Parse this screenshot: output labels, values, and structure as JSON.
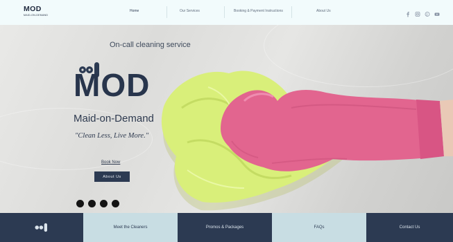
{
  "header": {
    "brand_name": "MOD",
    "brand_sub": "MAID-ON-DEMAND",
    "nav": [
      {
        "label": "Home",
        "active": true
      },
      {
        "label": "Our Services",
        "active": false
      },
      {
        "label": "Booking & Payment Instructions",
        "active": false
      },
      {
        "label": "About Us",
        "active": false
      }
    ],
    "social_icons": [
      "facebook-icon",
      "instagram-icon",
      "pinterest-icon",
      "youtube-icon"
    ]
  },
  "hero": {
    "tagline": "On-call cleaning service",
    "title": "MOD",
    "subtitle": "Maid-on-Demand",
    "quote": "\"Clean Less, Live More.\"",
    "book_link": "Book Now",
    "about_button": "About Us",
    "social_icons": [
      "facebook-icon",
      "twitter-icon",
      "mail-icon",
      "instagram-icon"
    ]
  },
  "bottom_tiles": [
    {
      "label": "",
      "icon": "mod-logo-icon",
      "style": "dark"
    },
    {
      "label": "Meet the Cleaners",
      "style": "light"
    },
    {
      "label": "Promos & Packages",
      "style": "dark"
    },
    {
      "label": "FAQs",
      "style": "light"
    },
    {
      "label": "Contact Us",
      "style": "dark"
    }
  ],
  "colors": {
    "navy": "#2c3a52",
    "light_blue": "#c8dde3",
    "glove_pink": "#e2658f",
    "cloth_green": "#d9ef7a"
  }
}
